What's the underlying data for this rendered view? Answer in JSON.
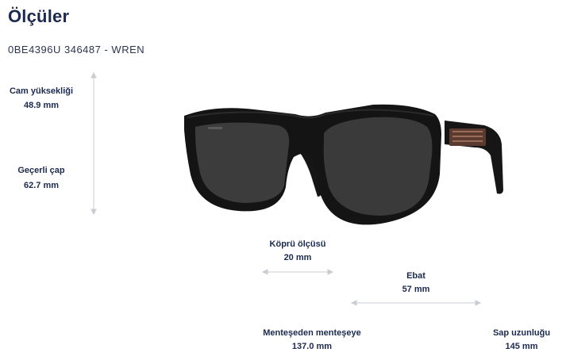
{
  "page": {
    "title": "Ölçüler",
    "model": "0BE4396U 346487 - WREN"
  },
  "measurements": {
    "lens_height": {
      "label": "Cam yüksekliği",
      "value": "48.9 mm"
    },
    "effective_diameter": {
      "label": "Geçerli çap",
      "value": "62.7 mm"
    },
    "bridge": {
      "label": "Köprü ölçüsü",
      "value": "20 mm"
    },
    "size": {
      "label": "Ebat",
      "value": "57 mm"
    },
    "hinge_to_hinge": {
      "label": "Menteşeden menteşeye",
      "value": "137.0 mm"
    },
    "temple_length": {
      "label": "Sap uzunluğu",
      "value": "145 mm"
    }
  },
  "colors": {
    "text": "#1b2a4e",
    "guide": "#c9ccd3",
    "frame": "#161616",
    "lens": "#3a3a3a"
  },
  "images": {
    "product": "sunglasses-product-image"
  }
}
